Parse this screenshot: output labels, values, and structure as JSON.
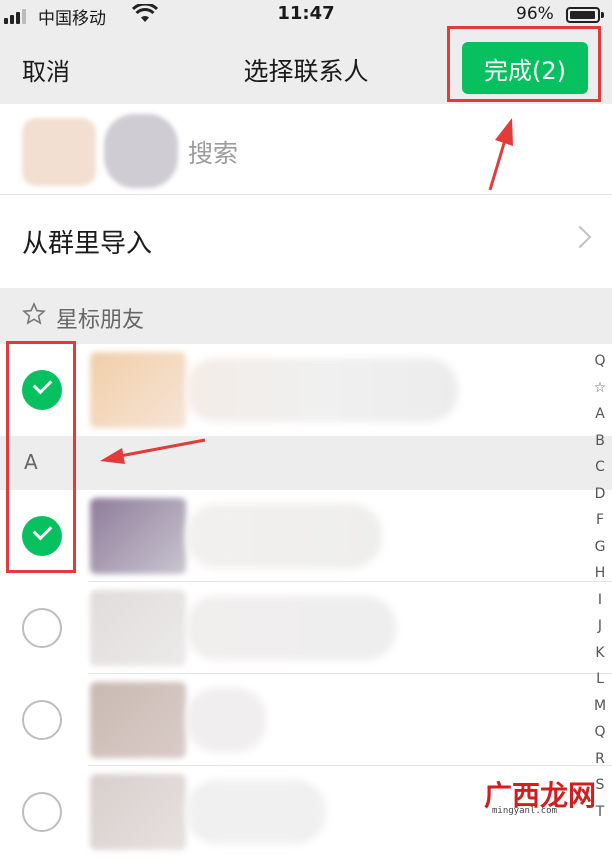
{
  "status_bar": {
    "carrier": "中国移动",
    "time": "11:47",
    "battery": "96%"
  },
  "nav": {
    "cancel_label": "取消",
    "title": "选择联系人",
    "done_label": "完成(2)"
  },
  "search": {
    "placeholder": "搜索"
  },
  "import_row": {
    "label": "从群里导入"
  },
  "sections": {
    "starred": "星标朋友",
    "a": "A"
  },
  "contacts": [
    {
      "selected": true
    },
    {
      "selected": true
    },
    {
      "selected": false
    },
    {
      "selected": false
    },
    {
      "selected": false
    }
  ],
  "index_letters": [
    "Q",
    "☆",
    "A",
    "B",
    "C",
    "D",
    "F",
    "G",
    "H",
    "I",
    "J",
    "K",
    "L",
    "M",
    "Q",
    "R",
    "S",
    "T"
  ],
  "watermark": {
    "text": "广西龙网",
    "url": "mingyanl.com"
  },
  "colors": {
    "accent": "#07c160",
    "annotation": "#e23b3b"
  }
}
